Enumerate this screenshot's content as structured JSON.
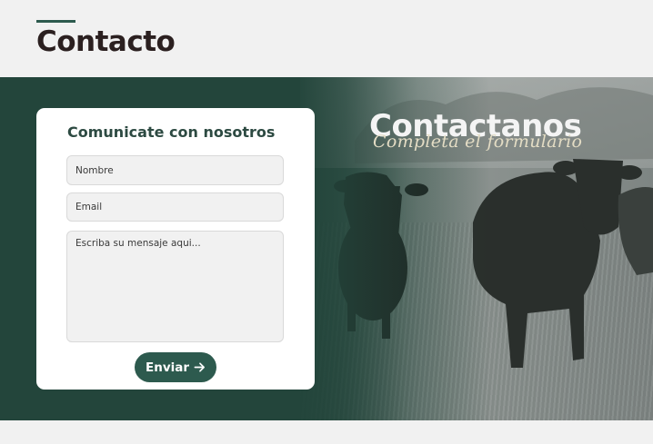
{
  "header": {
    "title": "Contacto"
  },
  "hero": {
    "title": "Contactanos",
    "subtitle": "Completa el formulario"
  },
  "form": {
    "heading": "Comunicate con nosotros",
    "name_placeholder": "Nombre",
    "email_placeholder": "Email",
    "message_placeholder": "Escriba su mensaje aqui...",
    "submit_label": "Enviar",
    "submit_icon": "arrow-right-icon"
  },
  "colors": {
    "accent": "#2d5a4e",
    "title_text": "#2b2020",
    "hero_green": "#23453b",
    "subtitle_cream": "#e3dcc4"
  }
}
